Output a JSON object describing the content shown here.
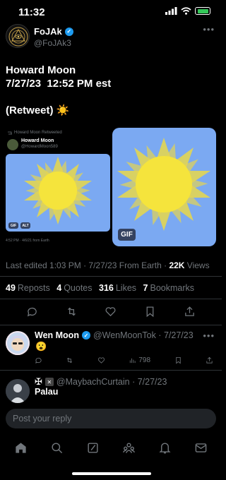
{
  "status_bar": {
    "time": "11:32"
  },
  "tweet": {
    "author_name": "FoJAk",
    "author_handle": "@FoJAk3",
    "text_lines": [
      "Howard Moon",
      "7/27/23  12:52 PM est",
      "",
      "(Retweet) ☀️"
    ],
    "retweet_card": {
      "label": "Howard Moon Retweeted",
      "name": "Howard Moon",
      "handle": "@HowardMoon589",
      "gif_badge": "GIF",
      "alt_badge": "ALT",
      "footer": "4:52 PM · 4/6/21 from Earth"
    },
    "gif_badge": "GIF",
    "meta": {
      "edited": "Last edited 1:03 PM · 7/27/23  From Earth · ",
      "views_count": "22K",
      "views_label": " Views"
    },
    "stats": [
      {
        "count": "49",
        "label": "Reposts"
      },
      {
        "count": "4",
        "label": "Quotes"
      },
      {
        "count": "316",
        "label": "Likes"
      },
      {
        "count": "7",
        "label": "Bookmarks"
      }
    ]
  },
  "replies": [
    {
      "name": "Wen Moon",
      "handle_time": "@WenMoonTok · 7/27/23",
      "text": "😮",
      "views": "798"
    },
    {
      "handle_time": "@MaybachCurtain · 7/27/23",
      "text": "Palau"
    }
  ],
  "composer": {
    "placeholder": "Post your reply"
  },
  "colors": {
    "accent": "#1d9bf0",
    "gif_background": "#7ba9f2",
    "sun": "#f5e43c",
    "sun_rays": "#e9d84a"
  }
}
